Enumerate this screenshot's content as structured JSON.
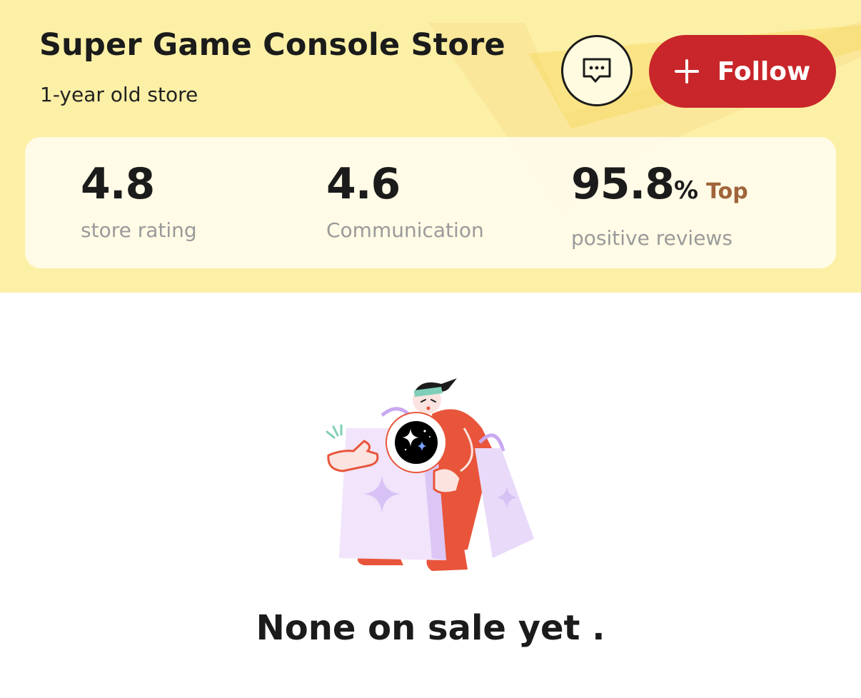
{
  "store": {
    "name": "Super Game Console Store",
    "age": "1-year old store"
  },
  "actions": {
    "follow_label": "Follow",
    "chat_icon": "chat-bubble-icon",
    "follow_icon": "plus-icon"
  },
  "stats": [
    {
      "value": "4.8",
      "label": "store rating"
    },
    {
      "value": "4.6",
      "label": "Communication"
    },
    {
      "value": "95.8",
      "unit": "%",
      "badge": "Top",
      "label": "positive reviews"
    }
  ],
  "empty_state": {
    "message": "None on sale yet ."
  },
  "colors": {
    "header_bg": "#fcf0a6",
    "accent_red": "#c8262a",
    "badge_brown": "#a0643a",
    "label_gray": "#9a9a9a"
  }
}
